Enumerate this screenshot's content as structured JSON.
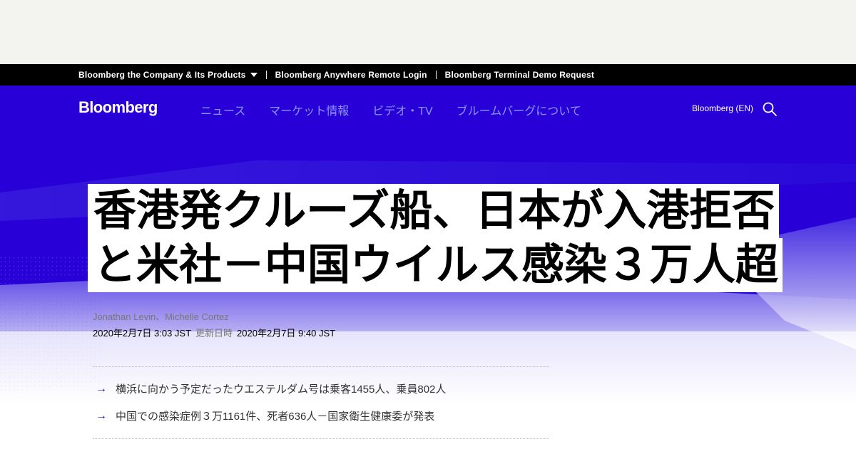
{
  "topbar": {
    "links": [
      {
        "label": "Bloomberg the Company & Its Products",
        "has_caret": true
      },
      {
        "label": "Bloomberg Anywhere Remote Login"
      },
      {
        "label": "Bloomberg Terminal Demo Request"
      }
    ]
  },
  "nav": {
    "logo": "Bloomberg",
    "links": [
      "ニュース",
      "マーケット情報",
      "ビデオ・TV",
      "ブルームバーグについて"
    ],
    "edition": "Bloomberg (EN)",
    "search_icon": "search-icon"
  },
  "article": {
    "headline_lines": [
      "香港発クルーズ船、日本が入港拒否",
      "と米社－中国ウイルス感染３万人超"
    ],
    "authors": "Jonathan Levin、Michelle Cortez",
    "published": "2020年2月7日 3:03 JST",
    "updated_label": "更新日時",
    "updated": "2020年2月7日 9:40 JST",
    "abstract": [
      "横浜に向かう予定だったウエステルダム号は乗客1455人、乗員802人",
      "中国での感染症例３万1161件、死者636人－国家衛生健康委が発表"
    ]
  },
  "colors": {
    "brand_blue": "#2800d7",
    "nav_link": "#8c94ff",
    "topbar_bg": "#000000",
    "ad_bg": "#f3f3f0"
  }
}
